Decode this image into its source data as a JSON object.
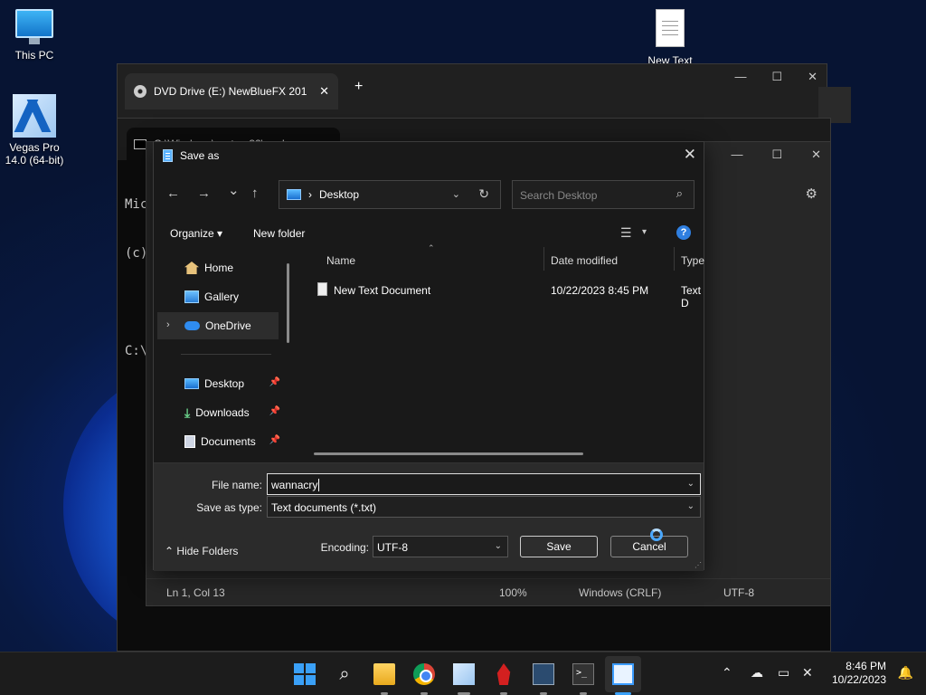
{
  "desktop": {
    "icons": [
      {
        "label": "This PC"
      },
      {
        "label": "Vegas Pro 14.0 (64-bit)"
      },
      {
        "label": "New Text"
      }
    ]
  },
  "explorer_window": {
    "tab_title": "DVD Drive (E:) NewBlueFX 201",
    "tab_close": "✕",
    "new_tab": "+",
    "caption": {
      "minimize": "—",
      "maximize": "☐",
      "close": "✕"
    }
  },
  "cmd_window": {
    "tab_title": "C:\\Windows\\system32\\cmd.e",
    "lines": [
      "Mic",
      "(c)",
      "",
      "C:\\"
    ]
  },
  "notepad_window": {
    "caption": {
      "minimize": "—",
      "maximize": "☐",
      "close": "✕"
    },
    "settings_icon": "⚙",
    "status": {
      "position": "Ln 1, Col 13",
      "zoom": "100%",
      "line_ending": "Windows (CRLF)",
      "encoding": "UTF-8"
    }
  },
  "save_dialog": {
    "title": "Save as",
    "close": "✕",
    "nav": {
      "back": "←",
      "forward": "→",
      "recent": "⌄",
      "up": "↑"
    },
    "address": {
      "separator": "›",
      "location": "Desktop",
      "dropdown": "⌄",
      "refresh": "↻"
    },
    "search_placeholder": "Search Desktop",
    "toolbar": {
      "organize": "Organize ▾",
      "new_folder": "New folder",
      "view_icon": "☰",
      "view_dropdown": "▾",
      "help": "?"
    },
    "nav_pane": [
      {
        "label": "Home"
      },
      {
        "label": "Gallery"
      },
      {
        "label": "OneDrive"
      },
      {
        "label": "Desktop"
      },
      {
        "label": "Downloads"
      },
      {
        "label": "Documents"
      }
    ],
    "pin": "📌",
    "expand": "›",
    "columns": {
      "name": "Name",
      "date": "Date modified",
      "type": "Type"
    },
    "files": [
      {
        "name": "New Text Document",
        "date": "10/22/2023 8:45 PM",
        "type": "Text D"
      }
    ],
    "file_name_label": "File name:",
    "file_name_value": "wannacry",
    "save_type_label": "Save as type:",
    "save_type_value": "Text documents (*.txt)",
    "encoding_label": "Encoding:",
    "encoding_value": "UTF-8",
    "save_button": "Save",
    "cancel_button": "Cancel",
    "hide_folders": "Hide Folders",
    "hide_folders_icon": "⌃"
  },
  "taskbar": {
    "tray": {
      "chevron": "⌃"
    },
    "clock": {
      "time": "8:46 PM",
      "date": "10/22/2023"
    }
  }
}
